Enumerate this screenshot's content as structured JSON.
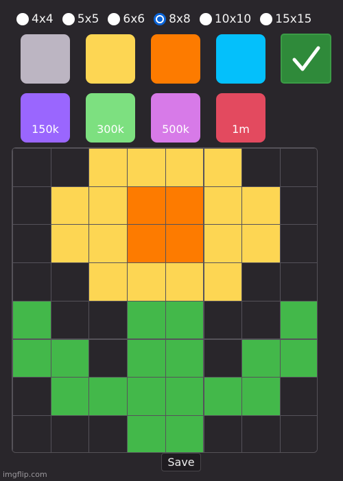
{
  "size_options": [
    {
      "label": "4x4",
      "selected": false
    },
    {
      "label": "5x5",
      "selected": false
    },
    {
      "label": "6x6",
      "selected": false
    },
    {
      "label": "8x8",
      "selected": true
    },
    {
      "label": "10x10",
      "selected": false
    },
    {
      "label": "15x15",
      "selected": false
    }
  ],
  "colors": {
    "gray": "#bcb5c2",
    "yellow": "#fdd653",
    "orange": "#fd7b00",
    "blue": "#04c0fb",
    "confirm": "#2f8a3a",
    "purple": "#9a66fe",
    "green_light": "#7de080",
    "pink": "#d77ae8",
    "red": "#e34a5f",
    "cell_empty": "#29262b",
    "cell_yellow": "#fdd653",
    "cell_orange": "#fd7b00",
    "cell_green": "#43b84a"
  },
  "color_swatches": [
    {
      "name": "gray",
      "color": "#bcb5c2"
    },
    {
      "name": "yellow",
      "color": "#fdd653"
    },
    {
      "name": "orange",
      "color": "#fd7b00"
    },
    {
      "name": "blue",
      "color": "#04c0fb"
    }
  ],
  "confirm_icon": "checkmark-icon",
  "price_swatches": [
    {
      "label": "150k",
      "color": "#9a66fe"
    },
    {
      "label": "300k",
      "color": "#7de080"
    },
    {
      "label": "500k",
      "color": "#d77ae8"
    },
    {
      "label": "1m",
      "color": "#e34a5f"
    }
  ],
  "grid": {
    "size": 8,
    "rows": [
      [
        "e",
        "e",
        "y",
        "y",
        "y",
        "y",
        "e",
        "e"
      ],
      [
        "e",
        "y",
        "y",
        "o",
        "o",
        "y",
        "y",
        "e"
      ],
      [
        "e",
        "y",
        "y",
        "o",
        "o",
        "y",
        "y",
        "e"
      ],
      [
        "e",
        "e",
        "y",
        "y",
        "y",
        "y",
        "e",
        "e"
      ],
      [
        "g",
        "e",
        "e",
        "g",
        "g",
        "e",
        "e",
        "g"
      ],
      [
        "g",
        "g",
        "e",
        "g",
        "g",
        "e",
        "g",
        "g"
      ],
      [
        "e",
        "g",
        "g",
        "g",
        "g",
        "g",
        "g",
        "e"
      ],
      [
        "e",
        "e",
        "e",
        "g",
        "g",
        "e",
        "e",
        "e"
      ]
    ]
  },
  "save_label": "Save",
  "watermark": "imgflip.com"
}
